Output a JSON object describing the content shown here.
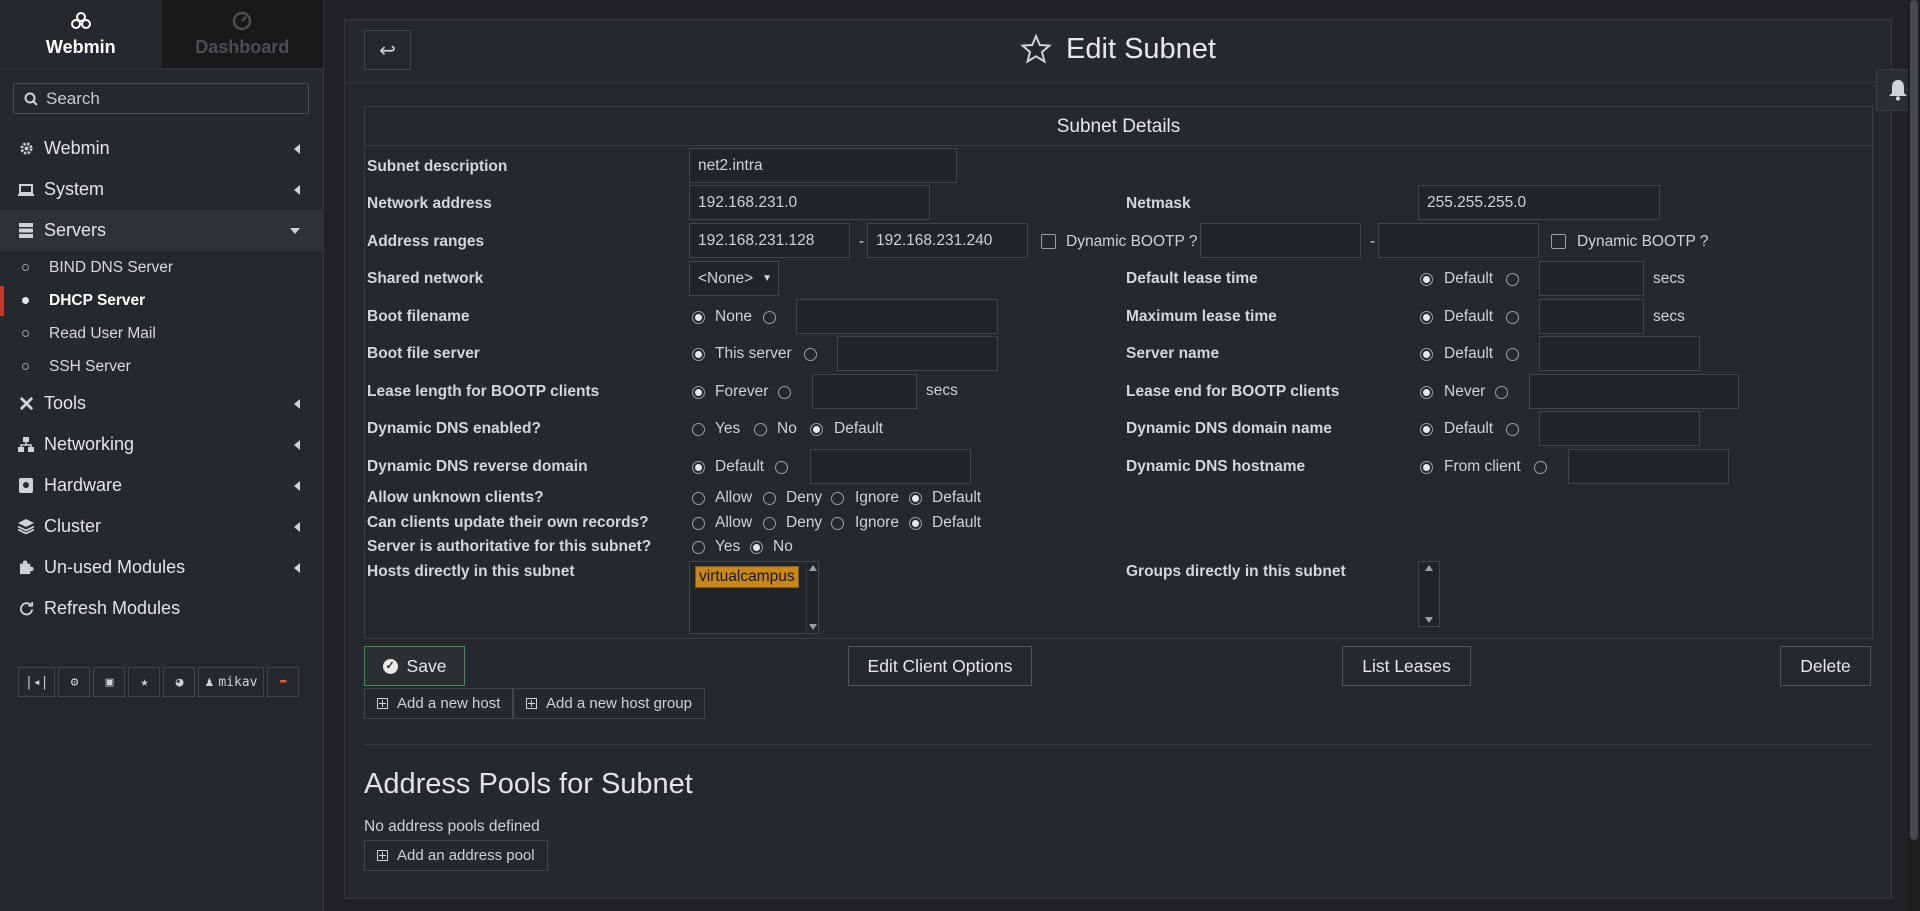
{
  "sidebar": {
    "tab_webmin": "Webmin",
    "tab_dashboard": "Dashboard",
    "search_placeholder": "Search",
    "menu": {
      "webmin": "Webmin",
      "system": "System",
      "servers": "Servers",
      "tools": "Tools",
      "networking": "Networking",
      "hardware": "Hardware",
      "cluster": "Cluster",
      "unused": "Un-used Modules",
      "refresh": "Refresh Modules"
    },
    "servers_items": [
      "BIND DNS Server",
      "DHCP Server",
      "Read User Mail",
      "SSH Server"
    ],
    "user": "mikav"
  },
  "page": {
    "title": "Edit Subnet",
    "section_title": "Subnet Details",
    "pools_title": "Address Pools for Subnet",
    "no_pools": "No address pools defined"
  },
  "labels": {
    "subnet_description": "Subnet description",
    "network_address": "Network address",
    "netmask": "Netmask",
    "address_ranges": "Address ranges",
    "shared_network": "Shared network",
    "default_lease_time": "Default lease time",
    "boot_filename": "Boot filename",
    "max_lease_time": "Maximum lease time",
    "boot_file_server": "Boot file server",
    "server_name": "Server name",
    "lease_length_bootp": "Lease length for BOOTP clients",
    "lease_end_bootp": "Lease end for BOOTP clients",
    "ddns_enabled": "Dynamic DNS enabled?",
    "ddns_domain": "Dynamic DNS domain name",
    "ddns_reverse": "Dynamic DNS reverse domain",
    "ddns_hostname": "Dynamic DNS hostname",
    "allow_unknown": "Allow unknown clients?",
    "clients_update": "Can clients update their own records?",
    "authoritative": "Server is authoritative for this subnet?",
    "hosts_in_subnet": "Hosts directly in this subnet",
    "groups_in_subnet": "Groups directly in this subnet"
  },
  "values": {
    "subnet_description": "net2.intra",
    "network_address": "192.168.231.0",
    "netmask": "255.255.255.0",
    "range_start": "192.168.231.128",
    "range_end": "192.168.231.240",
    "range_sep": "-",
    "dynamic_bootp": "Dynamic BOOTP ?",
    "shared_network": "<None>",
    "host_item": "virtualcampus"
  },
  "options": {
    "default": "Default",
    "none": "None",
    "this_server": "This server",
    "forever": "Forever",
    "never": "Never",
    "yes": "Yes",
    "no": "No",
    "from_client": "From client",
    "allow": "Allow",
    "deny": "Deny",
    "ignore": "Ignore",
    "secs": "secs"
  },
  "buttons": {
    "save": "Save",
    "edit_client_options": "Edit Client Options",
    "list_leases": "List Leases",
    "delete": "Delete",
    "add_host": "Add a new host",
    "add_host_group": "Add a new host group",
    "add_pool": "Add an address pool"
  }
}
